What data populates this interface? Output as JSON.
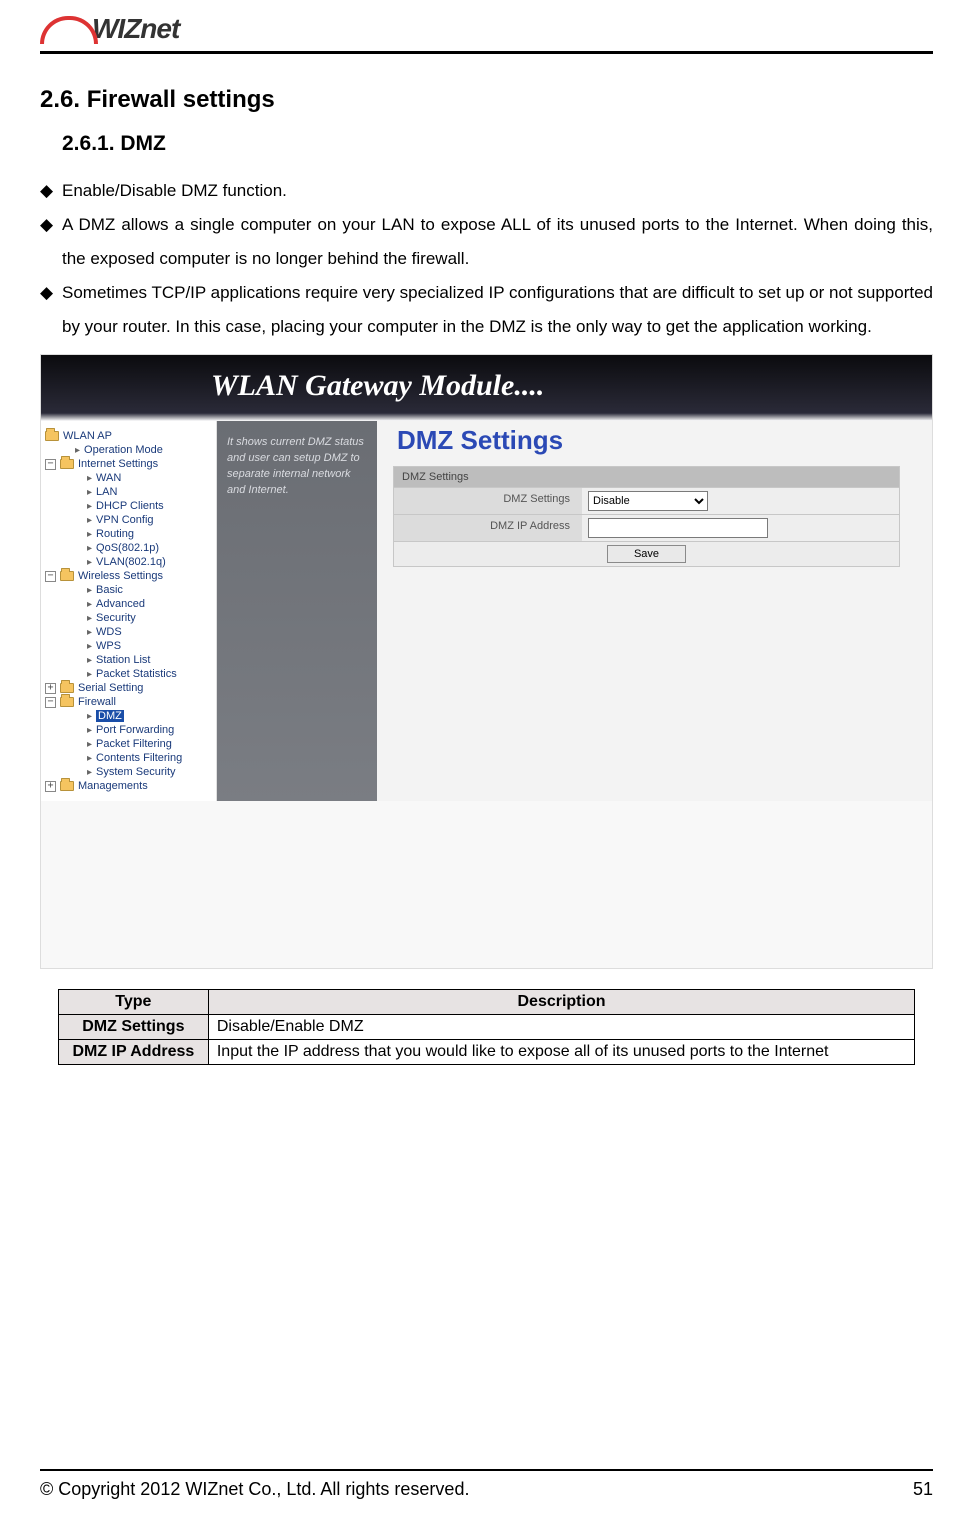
{
  "logo": "WIZnet",
  "heading_section": "2.6. Firewall settings",
  "heading_sub": "2.6.1.  DMZ",
  "bullets": [
    "Enable/Disable DMZ function.",
    "A DMZ allows a single computer on your LAN to expose ALL of its unused ports to the Internet. When doing this, the exposed computer is no longer behind the firewall.",
    "Sometimes TCP/IP applications require very specialized IP configurations that are difficult to set up or not supported by your router. In this case, placing your computer in the DMZ is the only way to get the application working."
  ],
  "banner": "WLAN Gateway Module....",
  "nav": {
    "root": "WLAN AP",
    "op_mode": "Operation Mode",
    "internet": "Internet Settings",
    "internet_items": [
      "WAN",
      "LAN",
      "DHCP Clients",
      "VPN Config",
      "Routing",
      "QoS(802.1p)",
      "VLAN(802.1q)"
    ],
    "wireless": "Wireless Settings",
    "wireless_items": [
      "Basic",
      "Advanced",
      "Security",
      "WDS",
      "WPS",
      "Station List",
      "Packet Statistics"
    ],
    "serial": "Serial Setting",
    "firewall": "Firewall",
    "firewall_items": [
      "DMZ",
      "Port Forwarding",
      "Packet Filtering",
      "Contents Filtering",
      "System Security"
    ],
    "managements": "Managements"
  },
  "sidebar_note": "It shows current DMZ status and user can setup DMZ to separate internal network and Internet.",
  "dmz_title": "DMZ Settings",
  "panel_title": "DMZ Settings",
  "form": {
    "row1_label": "DMZ Settings",
    "row1_value": "Disable",
    "row2_label": "DMZ IP Address",
    "row2_value": "",
    "save": "Save"
  },
  "table": {
    "h1": "Type",
    "h2": "Description",
    "r1k": "DMZ Settings",
    "r1v": "Disable/Enable DMZ",
    "r2k": "DMZ IP Address",
    "r2v": "Input the IP address that you would like to expose all of its unused ports to the Internet"
  },
  "footer_left": "© Copyright 2012 WIZnet Co., Ltd. All rights reserved.",
  "footer_right": "51"
}
